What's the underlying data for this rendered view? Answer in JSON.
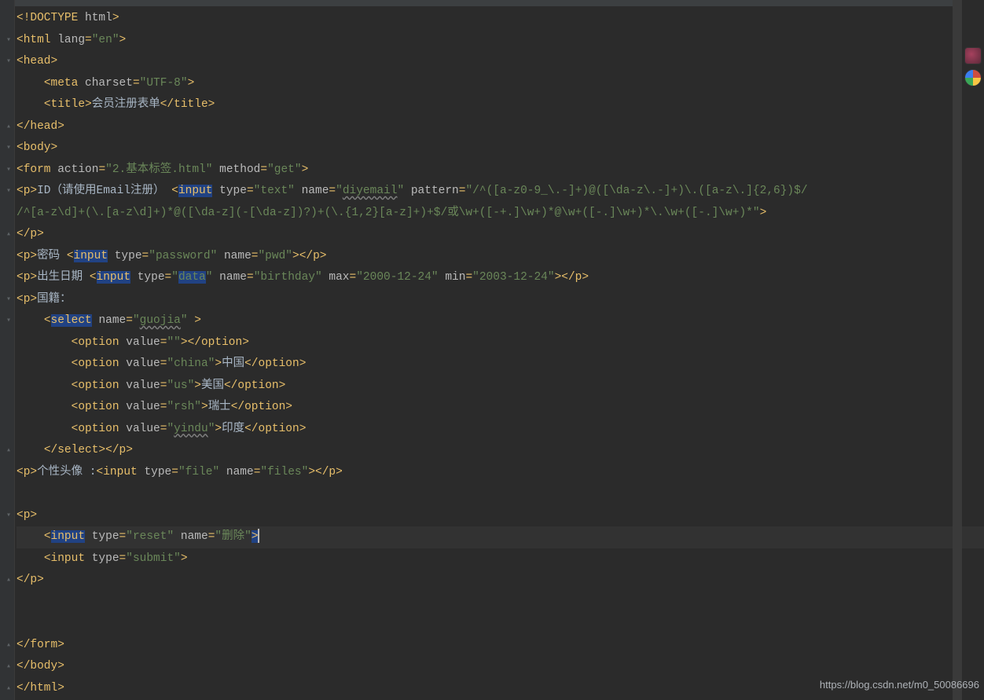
{
  "code": {
    "lines": [
      {
        "fold": "",
        "parts": [
          {
            "c": "t-tag",
            "t": "<!DOCTYPE "
          },
          {
            "c": "t-attr",
            "t": "html"
          },
          {
            "c": "t-tag",
            "t": ">"
          }
        ]
      },
      {
        "fold": "▾",
        "parts": [
          {
            "c": "t-tag",
            "t": "<html "
          },
          {
            "c": "t-attr",
            "t": "lang"
          },
          {
            "c": "t-tag",
            "t": "="
          },
          {
            "c": "t-str",
            "t": "\"en\""
          },
          {
            "c": "t-tag",
            "t": ">"
          }
        ]
      },
      {
        "fold": "▾",
        "parts": [
          {
            "c": "t-tag",
            "t": "<head>"
          }
        ]
      },
      {
        "fold": "",
        "parts": [
          {
            "c": "",
            "t": "    "
          },
          {
            "c": "t-tag",
            "t": "<meta "
          },
          {
            "c": "t-attr",
            "t": "charset"
          },
          {
            "c": "t-tag",
            "t": "="
          },
          {
            "c": "t-str",
            "t": "\"UTF-8\""
          },
          {
            "c": "t-tag",
            "t": ">"
          }
        ]
      },
      {
        "fold": "",
        "parts": [
          {
            "c": "",
            "t": "    "
          },
          {
            "c": "t-tag",
            "t": "<title>"
          },
          {
            "c": "t-text",
            "t": "会员注册表单"
          },
          {
            "c": "t-tag",
            "t": "</title>"
          }
        ]
      },
      {
        "fold": "▴",
        "parts": [
          {
            "c": "t-tag",
            "t": "</head>"
          }
        ]
      },
      {
        "fold": "▾",
        "parts": [
          {
            "c": "t-tag",
            "t": "<body>"
          }
        ]
      },
      {
        "fold": "▾",
        "parts": [
          {
            "c": "t-tag",
            "t": "<form "
          },
          {
            "c": "t-attr",
            "t": "action"
          },
          {
            "c": "t-tag",
            "t": "="
          },
          {
            "c": "t-str",
            "t": "\"2.基本标签.html\""
          },
          {
            "c": "t-tag",
            "t": " "
          },
          {
            "c": "t-attr",
            "t": "method"
          },
          {
            "c": "t-tag",
            "t": "="
          },
          {
            "c": "t-str",
            "t": "\"get\""
          },
          {
            "c": "t-tag",
            "t": ">"
          }
        ]
      },
      {
        "fold": "▾",
        "parts": [
          {
            "c": "t-tag",
            "t": "<p>"
          },
          {
            "c": "t-text",
            "t": "ID（请使用Email注册） "
          },
          {
            "c": "t-tag",
            "t": "<"
          },
          {
            "c": "hl-input",
            "t": "input"
          },
          {
            "c": "t-tag",
            "t": " "
          },
          {
            "c": "t-attr",
            "t": "type"
          },
          {
            "c": "t-tag",
            "t": "="
          },
          {
            "c": "t-str",
            "t": "\"text\""
          },
          {
            "c": "t-tag",
            "t": " "
          },
          {
            "c": "t-attr",
            "t": "name"
          },
          {
            "c": "t-tag",
            "t": "="
          },
          {
            "c": "t-str",
            "t": "\""
          },
          {
            "c": "t-str underline-wave",
            "t": "diyemail"
          },
          {
            "c": "t-str",
            "t": "\""
          },
          {
            "c": "t-tag",
            "t": " "
          },
          {
            "c": "t-attr",
            "t": "pattern"
          },
          {
            "c": "t-tag",
            "t": "="
          },
          {
            "c": "t-str",
            "t": "\"/^([a-z0-9_\\.-]+)@([\\da-z\\.-]+)\\.([a-z\\.]{2,6})$/"
          }
        ]
      },
      {
        "fold": "",
        "parts": [
          {
            "c": "t-str",
            "t": "/^[a-z\\d]+(\\.[a-z\\d]+)*@([\\da-z](-[\\da-z])?)+(\\.{1,2}[a-z]+)+$/或\\w+([-+.]\\w+)*@\\w+([-.]\\w+)*\\.\\w+([-.]\\w+)*\""
          },
          {
            "c": "t-tag",
            "t": ">"
          }
        ]
      },
      {
        "fold": "▴",
        "parts": [
          {
            "c": "t-tag",
            "t": "</p>"
          }
        ]
      },
      {
        "fold": "",
        "parts": [
          {
            "c": "t-tag",
            "t": "<p>"
          },
          {
            "c": "t-text",
            "t": "密码 "
          },
          {
            "c": "t-tag",
            "t": "<"
          },
          {
            "c": "hl-input",
            "t": "input"
          },
          {
            "c": "t-tag",
            "t": " "
          },
          {
            "c": "t-attr",
            "t": "type"
          },
          {
            "c": "t-tag",
            "t": "="
          },
          {
            "c": "t-str",
            "t": "\"password\""
          },
          {
            "c": "t-tag",
            "t": " "
          },
          {
            "c": "t-attr",
            "t": "name"
          },
          {
            "c": "t-tag",
            "t": "="
          },
          {
            "c": "t-str",
            "t": "\"pwd\""
          },
          {
            "c": "t-tag",
            "t": "></p>"
          }
        ]
      },
      {
        "fold": "",
        "parts": [
          {
            "c": "t-tag",
            "t": "<p>"
          },
          {
            "c": "t-text",
            "t": "出生日期 "
          },
          {
            "c": "t-tag",
            "t": "<"
          },
          {
            "c": "hl-input",
            "t": "input"
          },
          {
            "c": "t-tag",
            "t": " "
          },
          {
            "c": "t-attr",
            "t": "type"
          },
          {
            "c": "t-tag",
            "t": "="
          },
          {
            "c": "t-str",
            "t": "\""
          },
          {
            "c": "hl-data",
            "t": "data"
          },
          {
            "c": "t-str",
            "t": "\""
          },
          {
            "c": "t-tag",
            "t": " "
          },
          {
            "c": "t-attr",
            "t": "name"
          },
          {
            "c": "t-tag",
            "t": "="
          },
          {
            "c": "t-str",
            "t": "\"birthday\""
          },
          {
            "c": "t-tag",
            "t": " "
          },
          {
            "c": "t-attr",
            "t": "max"
          },
          {
            "c": "t-tag",
            "t": "="
          },
          {
            "c": "t-str",
            "t": "\"2000-12-24\""
          },
          {
            "c": "t-tag",
            "t": " "
          },
          {
            "c": "t-attr",
            "t": "min"
          },
          {
            "c": "t-tag",
            "t": "="
          },
          {
            "c": "t-str",
            "t": "\"2003-12-24\""
          },
          {
            "c": "t-tag",
            "t": "></p>"
          }
        ]
      },
      {
        "fold": "▾",
        "parts": [
          {
            "c": "t-tag",
            "t": "<p>"
          },
          {
            "c": "t-text",
            "t": "国籍："
          }
        ]
      },
      {
        "fold": "▾",
        "parts": [
          {
            "c": "",
            "t": "    "
          },
          {
            "c": "t-tag",
            "t": "<"
          },
          {
            "c": "hl-select",
            "t": "select"
          },
          {
            "c": "t-tag",
            "t": " "
          },
          {
            "c": "t-attr",
            "t": "name"
          },
          {
            "c": "t-tag",
            "t": "="
          },
          {
            "c": "t-str",
            "t": "\""
          },
          {
            "c": "t-str underline-wave",
            "t": "guojia"
          },
          {
            "c": "t-str",
            "t": "\""
          },
          {
            "c": "t-tag",
            "t": " >"
          }
        ]
      },
      {
        "fold": "",
        "parts": [
          {
            "c": "",
            "t": "        "
          },
          {
            "c": "t-tag",
            "t": "<option "
          },
          {
            "c": "t-attr",
            "t": "value"
          },
          {
            "c": "t-tag",
            "t": "="
          },
          {
            "c": "t-str",
            "t": "\"\""
          },
          {
            "c": "t-tag",
            "t": "></option>"
          }
        ]
      },
      {
        "fold": "",
        "parts": [
          {
            "c": "",
            "t": "        "
          },
          {
            "c": "t-tag",
            "t": "<option "
          },
          {
            "c": "t-attr",
            "t": "value"
          },
          {
            "c": "t-tag",
            "t": "="
          },
          {
            "c": "t-str",
            "t": "\"china\""
          },
          {
            "c": "t-tag",
            "t": ">"
          },
          {
            "c": "t-text",
            "t": "中国"
          },
          {
            "c": "t-tag",
            "t": "</option>"
          }
        ]
      },
      {
        "fold": "",
        "parts": [
          {
            "c": "",
            "t": "        "
          },
          {
            "c": "t-tag",
            "t": "<option "
          },
          {
            "c": "t-attr",
            "t": "value"
          },
          {
            "c": "t-tag",
            "t": "="
          },
          {
            "c": "t-str",
            "t": "\"us\""
          },
          {
            "c": "t-tag",
            "t": ">"
          },
          {
            "c": "t-text",
            "t": "美国"
          },
          {
            "c": "t-tag",
            "t": "</option>"
          }
        ]
      },
      {
        "fold": "",
        "parts": [
          {
            "c": "",
            "t": "        "
          },
          {
            "c": "t-tag",
            "t": "<option "
          },
          {
            "c": "t-attr",
            "t": "value"
          },
          {
            "c": "t-tag",
            "t": "="
          },
          {
            "c": "t-str",
            "t": "\"rsh\""
          },
          {
            "c": "t-tag",
            "t": ">"
          },
          {
            "c": "t-text",
            "t": "瑞士"
          },
          {
            "c": "t-tag",
            "t": "</option>"
          }
        ]
      },
      {
        "fold": "",
        "parts": [
          {
            "c": "",
            "t": "        "
          },
          {
            "c": "t-tag",
            "t": "<option "
          },
          {
            "c": "t-attr",
            "t": "value"
          },
          {
            "c": "t-tag",
            "t": "="
          },
          {
            "c": "t-str",
            "t": "\""
          },
          {
            "c": "t-str underline-wave",
            "t": "yindu"
          },
          {
            "c": "t-str",
            "t": "\""
          },
          {
            "c": "t-tag",
            "t": ">"
          },
          {
            "c": "t-text",
            "t": "印度"
          },
          {
            "c": "t-tag",
            "t": "</option>"
          }
        ]
      },
      {
        "fold": "▴",
        "parts": [
          {
            "c": "",
            "t": "    "
          },
          {
            "c": "t-tag",
            "t": "</select></p>"
          }
        ]
      },
      {
        "fold": "",
        "parts": [
          {
            "c": "t-tag",
            "t": "<p>"
          },
          {
            "c": "t-text",
            "t": "个性头像 :"
          },
          {
            "c": "t-tag",
            "t": "<input "
          },
          {
            "c": "t-attr",
            "t": "type"
          },
          {
            "c": "t-tag",
            "t": "="
          },
          {
            "c": "t-str",
            "t": "\"file\""
          },
          {
            "c": "t-tag",
            "t": " "
          },
          {
            "c": "t-attr",
            "t": "name"
          },
          {
            "c": "t-tag",
            "t": "="
          },
          {
            "c": "t-str",
            "t": "\"files\""
          },
          {
            "c": "t-tag",
            "t": "></p>"
          }
        ]
      },
      {
        "fold": "",
        "parts": []
      },
      {
        "fold": "▾",
        "parts": [
          {
            "c": "t-tag",
            "t": "<p>"
          }
        ]
      },
      {
        "fold": "",
        "active": true,
        "parts": [
          {
            "c": "",
            "t": "    "
          },
          {
            "c": "t-tag",
            "t": "<"
          },
          {
            "c": "hl-input",
            "t": "input"
          },
          {
            "c": "t-tag",
            "t": " "
          },
          {
            "c": "t-attr",
            "t": "type"
          },
          {
            "c": "t-tag",
            "t": "="
          },
          {
            "c": "t-str",
            "t": "\"reset\""
          },
          {
            "c": "t-tag",
            "t": " "
          },
          {
            "c": "t-attr",
            "t": "name"
          },
          {
            "c": "t-tag",
            "t": "="
          },
          {
            "c": "t-str",
            "t": "\"删除\""
          },
          {
            "c": "hl-input",
            "t": ">"
          }
        ]
      },
      {
        "fold": "",
        "parts": [
          {
            "c": "",
            "t": "    "
          },
          {
            "c": "t-tag",
            "t": "<input "
          },
          {
            "c": "t-attr",
            "t": "type"
          },
          {
            "c": "t-tag",
            "t": "="
          },
          {
            "c": "t-str",
            "t": "\"submit\""
          },
          {
            "c": "t-tag",
            "t": ">"
          }
        ]
      },
      {
        "fold": "▴",
        "parts": [
          {
            "c": "t-tag",
            "t": "</p>"
          }
        ]
      },
      {
        "fold": "",
        "parts": []
      },
      {
        "fold": "",
        "parts": []
      },
      {
        "fold": "▴",
        "parts": [
          {
            "c": "t-tag",
            "t": "</form>"
          }
        ]
      },
      {
        "fold": "▴",
        "parts": [
          {
            "c": "t-tag",
            "t": "</body>"
          }
        ]
      },
      {
        "fold": "▴",
        "parts": [
          {
            "c": "t-tag",
            "t": "</html>"
          }
        ]
      }
    ]
  },
  "status": {
    "url": "https://blog.csdn.net/m0_50086696"
  }
}
